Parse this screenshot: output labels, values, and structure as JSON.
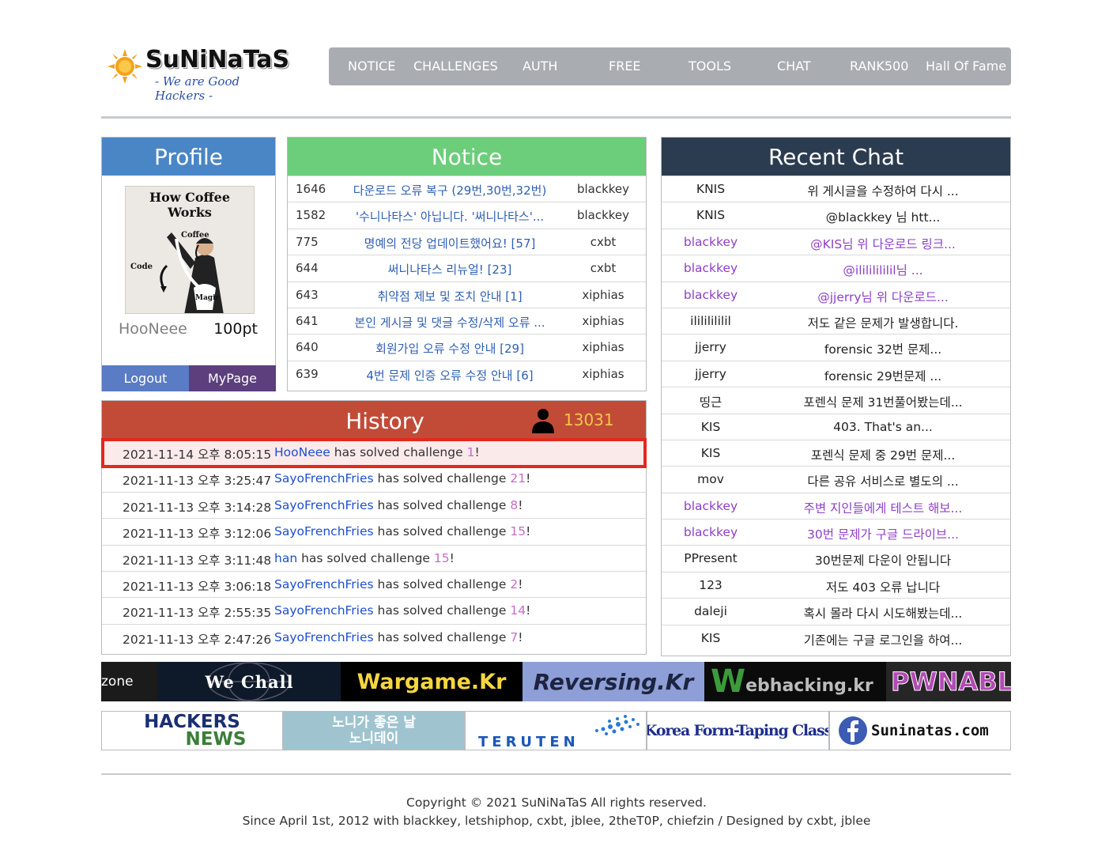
{
  "logo": {
    "title": "SuNiNaTaS",
    "slogan": "- We are Good Hackers -"
  },
  "nav": [
    "NOTICE",
    "CHALLENGES",
    "AUTH",
    "FREE",
    "TOOLS",
    "CHAT",
    "RANK500",
    "Hall Of Fame"
  ],
  "profile": {
    "heading": "Profile",
    "avatar_caption": "How Coffee Works",
    "avatar_labels": [
      "Coffee",
      "Code",
      "Magic"
    ],
    "username": "HooNeee",
    "points": "100pt",
    "logout": "Logout",
    "mypage": "MyPage"
  },
  "notice": {
    "heading": "Notice",
    "rows": [
      {
        "no": "1646",
        "title": "다운로드 오류 복구 (29번,30번,32번)",
        "author": "blackkey"
      },
      {
        "no": "1582",
        "title": "'수니나타스' 아닙니다. '써니나타스'...",
        "author": "blackkey"
      },
      {
        "no": "775",
        "title": "명예의 전당 업데이트했어요! [57]",
        "author": "cxbt"
      },
      {
        "no": "644",
        "title": "써니나타스 리뉴얼! [23]",
        "author": "cxbt"
      },
      {
        "no": "643",
        "title": "취약점 제보 및 조치 안내 [1]",
        "author": "xiphias"
      },
      {
        "no": "641",
        "title": "본인 게시글 및 댓글 수정/삭제 오류 ...",
        "author": "xiphias"
      },
      {
        "no": "640",
        "title": "회원가입 오류 수정 안내 [29]",
        "author": "xiphias"
      },
      {
        "no": "639",
        "title": "4번 문제 인증 오류 수정 안내 [6]",
        "author": "xiphias"
      }
    ]
  },
  "history": {
    "heading": "History",
    "count": "13031",
    "solved_text": "has solved challenge",
    "rows": [
      {
        "date": "2021-11-14 오후 8:05:15",
        "user": "HooNeee",
        "num": "1"
      },
      {
        "date": "2021-11-13 오후 3:25:47",
        "user": "SayoFrenchFries",
        "num": "21"
      },
      {
        "date": "2021-11-13 오후 3:14:28",
        "user": "SayoFrenchFries",
        "num": "8"
      },
      {
        "date": "2021-11-13 오후 3:12:06",
        "user": "SayoFrenchFries",
        "num": "15"
      },
      {
        "date": "2021-11-13 오후 3:11:48",
        "user": "han",
        "num": "15"
      },
      {
        "date": "2021-11-13 오후 3:06:18",
        "user": "SayoFrenchFries",
        "num": "2"
      },
      {
        "date": "2021-11-13 오후 2:55:35",
        "user": "SayoFrenchFries",
        "num": "14"
      },
      {
        "date": "2021-11-13 오후 2:47:26",
        "user": "SayoFrenchFries",
        "num": "7"
      }
    ]
  },
  "chat": {
    "heading": "Recent Chat",
    "rows": [
      {
        "name": "KNIS",
        "text": "위 게시글을 수정하여 다시 ...",
        "admin": false
      },
      {
        "name": "KNIS",
        "text": "@blackkey 님 htt...",
        "admin": false
      },
      {
        "name": "blackkey",
        "text": "@KIS님 위 다운로드 링크...",
        "admin": true
      },
      {
        "name": "blackkey",
        "text": "@ilililililil님 ...",
        "admin": true
      },
      {
        "name": "blackkey",
        "text": "@jjerry님 위 다운로드...",
        "admin": true
      },
      {
        "name": "ilililililil",
        "text": "저도 같은 문제가 발생합니다.",
        "admin": false
      },
      {
        "name": "jjerry",
        "text": "forensic 32번 문제...",
        "admin": false
      },
      {
        "name": "jjerry",
        "text": "forensic 29번문제 ...",
        "admin": false
      },
      {
        "name": "띵근",
        "text": "포렌식 문제 31번풀어봤는데...",
        "admin": false
      },
      {
        "name": "KIS",
        "text": "403. That's an...",
        "admin": false
      },
      {
        "name": "KIS",
        "text": "포렌식 문제 중 29번 문제...",
        "admin": false
      },
      {
        "name": "mov",
        "text": "다른 공유 서비스로 별도의 ...",
        "admin": false
      },
      {
        "name": "blackkey",
        "text": "주변 지인들에게 테스트 해보...",
        "admin": true
      },
      {
        "name": "blackkey",
        "text": "30번 문제가 구글 드라이브...",
        "admin": true
      },
      {
        "name": "PPresent",
        "text": "30번문제 다운이 안됩니다",
        "admin": false
      },
      {
        "name": "123",
        "text": "저도 403 오류 납니다",
        "admin": false
      },
      {
        "name": "daleji",
        "text": "혹시 몰라 다시 시도해봤는데...",
        "admin": false
      },
      {
        "name": "KIS",
        "text": "기존에는 구글 로그인을 하여...",
        "admin": false
      }
    ]
  },
  "banners_row1": [
    "zone",
    "We Chall",
    "Wargame.Kr",
    "Reversing.Kr",
    "W",
    "ebhacking.kr",
    "PWNABLE"
  ],
  "banners_row2": {
    "hackers": "HACKERS",
    "news": "NEWS",
    "noni_line1": "노니가 좋은 날",
    "noni_line2": "노니데이",
    "teruten": "TERUTEN",
    "korea_form": "Korea Form-Taping Class",
    "fb_text": "Suninatas.com"
  },
  "footer": {
    "line1": "Copyright © 2021 SuNiNaTaS All rights reserved.",
    "line2": "Since April 1st, 2012 with blackkey, letshiphop, cxbt, jblee, 2theT0P, chiefzin / Designed by cxbt, jblee"
  },
  "colors": {
    "profile": "#4a86c5",
    "notice": "#6ccd7a",
    "history": "#c24b37",
    "chat": "#2c3c50",
    "highlight": "#e2291c",
    "link": "#2f5fb3",
    "admin": "#8d3fc8"
  }
}
